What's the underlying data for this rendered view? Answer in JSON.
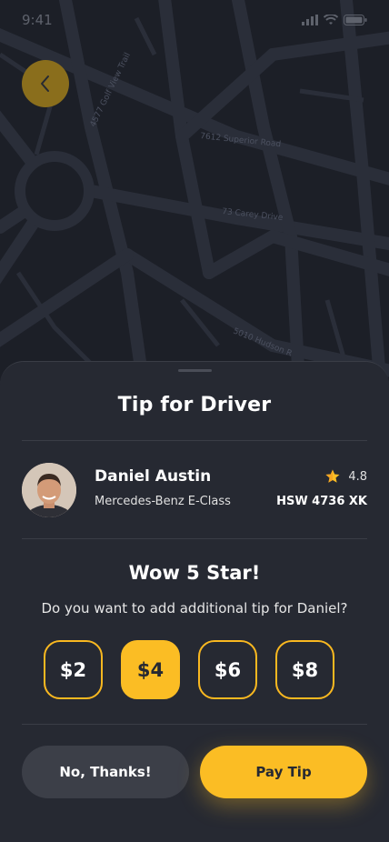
{
  "status_bar": {
    "time": "9:41"
  },
  "map": {
    "streets": [
      "4577 Golf View Trail",
      "7612 Superior Road",
      "73 Carey Drive",
      "5010 Hudson R"
    ]
  },
  "sheet": {
    "title": "Tip for Driver",
    "driver": {
      "name": "Daniel Austin",
      "car": "Mercedes-Benz E-Class",
      "rating": "4.8",
      "plate": "HSW 4736 XK"
    },
    "rating_title": "Wow 5 Star!",
    "question": "Do you want to add additional tip for Daniel?",
    "tips": [
      "$2",
      "$4",
      "$6",
      "$8"
    ],
    "selected_tip": "$4",
    "buttons": {
      "no_thanks": "No, Thanks!",
      "pay_tip": "Pay Tip"
    }
  },
  "colors": {
    "accent": "#fbbd24",
    "background": "#1c1f27",
    "sheet": "#262932"
  },
  "icons": [
    "back-arrow-icon",
    "star-icon",
    "signal-icon",
    "wifi-icon",
    "battery-icon"
  ]
}
